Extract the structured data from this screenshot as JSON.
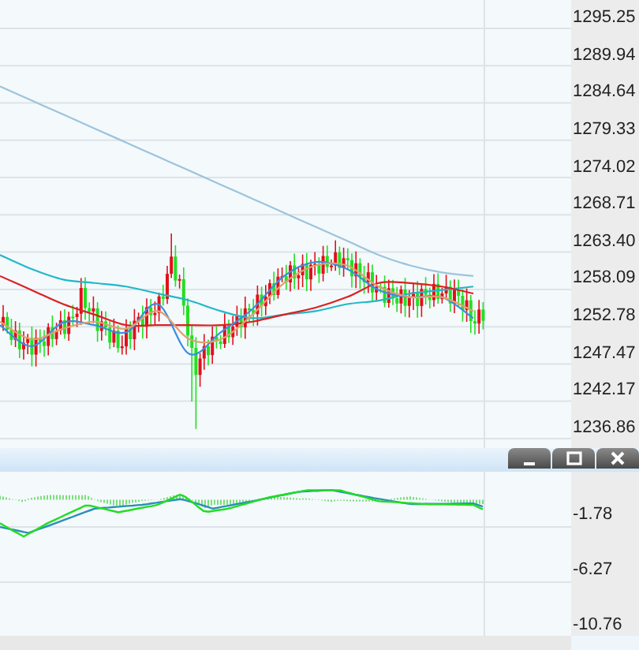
{
  "price_panel": {
    "chart_data": {
      "type": "line",
      "ylim": [
        1235.5,
        1299.3
      ],
      "grid": true,
      "yticks": [
        {
          "value": 1295.25,
          "label": "1295.25"
        },
        {
          "value": 1289.94,
          "label": "1289.94"
        },
        {
          "value": 1284.64,
          "label": "1284.64"
        },
        {
          "value": 1279.33,
          "label": "1279.33"
        },
        {
          "value": 1274.02,
          "label": "1274.02"
        },
        {
          "value": 1268.71,
          "label": "1268.71"
        },
        {
          "value": 1263.4,
          "label": "1263.40"
        },
        {
          "value": 1258.09,
          "label": "1258.09"
        },
        {
          "value": 1252.78,
          "label": "1252.78"
        },
        {
          "value": 1247.47,
          "label": "1247.47"
        },
        {
          "value": 1242.17,
          "label": "1242.17"
        },
        {
          "value": 1236.86,
          "label": "1236.86"
        }
      ],
      "series": [
        {
          "color": "#9cc4dc",
          "values": [
            1287,
            1285,
            1283,
            1281,
            1279,
            1277,
            1275,
            1273,
            1271,
            1269,
            1267,
            1265,
            1263,
            1261.5,
            1260.5,
            1260
          ]
        },
        {
          "color": "#22b8c8",
          "values": [
            1263,
            1261,
            1259.5,
            1259,
            1258.5,
            1257.5,
            1256.5,
            1255,
            1254,
            1254.5,
            1255,
            1256,
            1256.5,
            1257.5,
            1258,
            1258.5
          ]
        },
        {
          "color": "#dd2020",
          "values": [
            1260,
            1258,
            1256,
            1254.5,
            1253,
            1253,
            1253,
            1253,
            1253.5,
            1254.5,
            1255.5,
            1257,
            1259,
            1259,
            1258.5,
            1257.5
          ]
        },
        {
          "color": "#3a8ee0",
          "values": [
            1253,
            1250,
            1253.4,
            1253,
            1252,
            1256,
            1248.9,
            1252,
            1255.3,
            1260,
            1262,
            1261,
            1258,
            1257,
            1257,
            1254
          ]
        },
        {
          "color": "#e0a070",
          "values": [
            1253.5,
            1251,
            1252.5,
            1253.5,
            1252.5,
            1255,
            1251,
            1251,
            1254.5,
            1259,
            1261.5,
            1261.5,
            1258.5,
            1257,
            1257,
            1255
          ]
        }
      ]
    }
  },
  "panel_controls": [
    {
      "kind": "minimize"
    },
    {
      "kind": "maximize"
    },
    {
      "kind": "close"
    }
  ],
  "indicator_panel": {
    "axis_labels": [
      "-1.78",
      "-6.27",
      "-10.76"
    ]
  }
}
